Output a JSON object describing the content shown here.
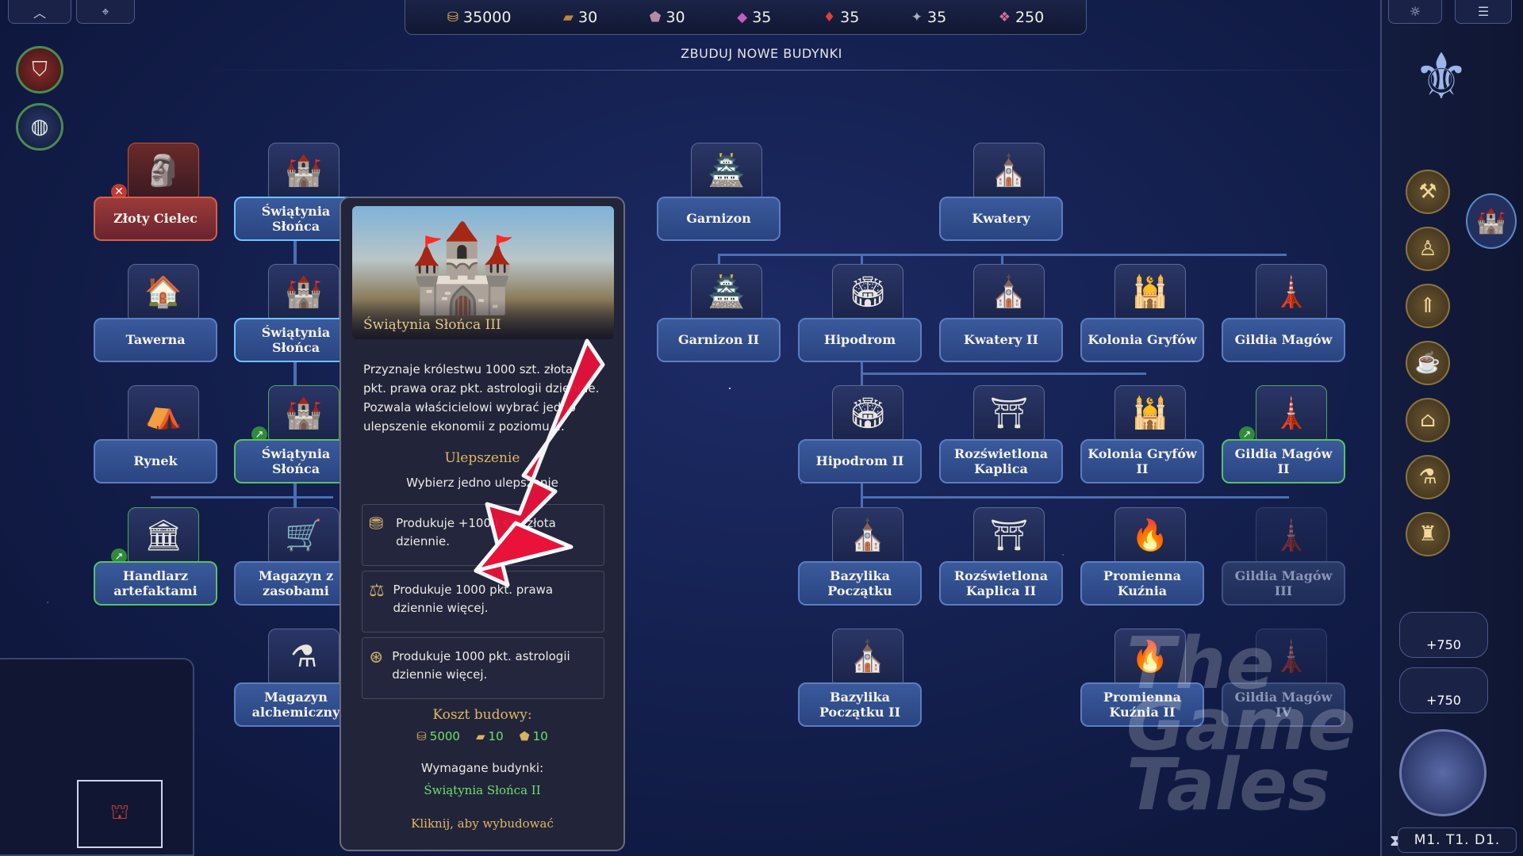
{
  "resources": [
    {
      "icon": "gold-icon",
      "glyph": "⛁",
      "value": "35000"
    },
    {
      "icon": "wood-icon",
      "glyph": "▰",
      "value": "30"
    },
    {
      "icon": "ore-icon",
      "glyph": "⬟",
      "value": "30"
    },
    {
      "icon": "gems-icon",
      "glyph": "◆",
      "value": "35"
    },
    {
      "icon": "crystal-icon",
      "glyph": "♦",
      "value": "35"
    },
    {
      "icon": "mercury-icon",
      "glyph": "✦",
      "value": "35"
    },
    {
      "icon": "dust-icon",
      "glyph": "❖",
      "value": "250"
    }
  ],
  "title": "ZBUDUJ NOWE BUDYNKI",
  "buildings": {
    "zloty_cielec": "Złoty Cielec",
    "swiatynia_1": "Świątynia Słońca",
    "swiatynia_2": "Świątynia Słońca",
    "swiatynia_3": "Świątynia Słońca",
    "tawerna": "Tawerna",
    "rynek": "Rynek",
    "handlarz": "Handlarz artefaktami",
    "magazyn_zasoby": "Magazyn z zasobami",
    "magazyn_alch": "Magazyn alchemiczny",
    "garnizon": "Garnizon",
    "garnizon2": "Garnizon II",
    "kwatery": "Kwatery",
    "kwatery2": "Kwatery II",
    "hipodrom": "Hipodrom",
    "hipodrom2": "Hipodrom II",
    "kaplica": "Rozświetlona Kaplica",
    "kaplica2": "Rozświetlona Kaplica II",
    "kolonia": "Kolonia Gryfów",
    "kolonia2": "Kolonia Gryfów II",
    "gildia": "Gildia Magów",
    "gildia2": "Gildia Magów II",
    "gildia3": "Gildia Magów III",
    "gildia4": "Gildia Magów IV",
    "bazylika": "Bazylika Początku",
    "bazylika2": "Bazylika Początku II",
    "kuznia": "Promienna Kuźnia",
    "kuznia2": "Promienna Kuźnia II"
  },
  "tooltip": {
    "name": "Świątynia Słońca III",
    "description": "Przyznaje królestwu 1000 szt. złota, pkt. prawa oraz pkt. astrologii dziennie. Pozwala właścicielowi wybrać jedno ulepszenie ekonomii z poziomu 2.",
    "upgrade_heading": "Ulepszenie",
    "upgrade_sub": "Wybierz jedno ulepszenie",
    "options": [
      {
        "icon": "gold-coins-icon",
        "glyph": "⛃",
        "text": "Produkuje +1000 szt. złota dziennie."
      },
      {
        "icon": "scales-icon",
        "glyph": "⚖",
        "text": "Produkuje 1000 pkt. prawa dziennie więcej."
      },
      {
        "icon": "astrology-icon",
        "glyph": "⊛",
        "text": "Produkuje 1000 pkt. astrologii dziennie więcej."
      }
    ],
    "cost_heading": "Koszt budowy:",
    "cost": [
      {
        "icon": "gold-icon",
        "glyph": "⛁",
        "value": "5000"
      },
      {
        "icon": "wood-icon",
        "glyph": "▰",
        "value": "10"
      },
      {
        "icon": "ore-icon",
        "glyph": "⬟",
        "value": "10"
      }
    ],
    "required_heading": "Wymagane budynki:",
    "required": "Świątynia Słońca II",
    "click_to_build": "Kliknij, aby wybudować"
  },
  "right_panel": {
    "bonus_1": "+750",
    "bonus_2": "+750",
    "turn": "M1. T1. D1."
  },
  "watermark": [
    "The",
    "Game",
    "Tales"
  ]
}
